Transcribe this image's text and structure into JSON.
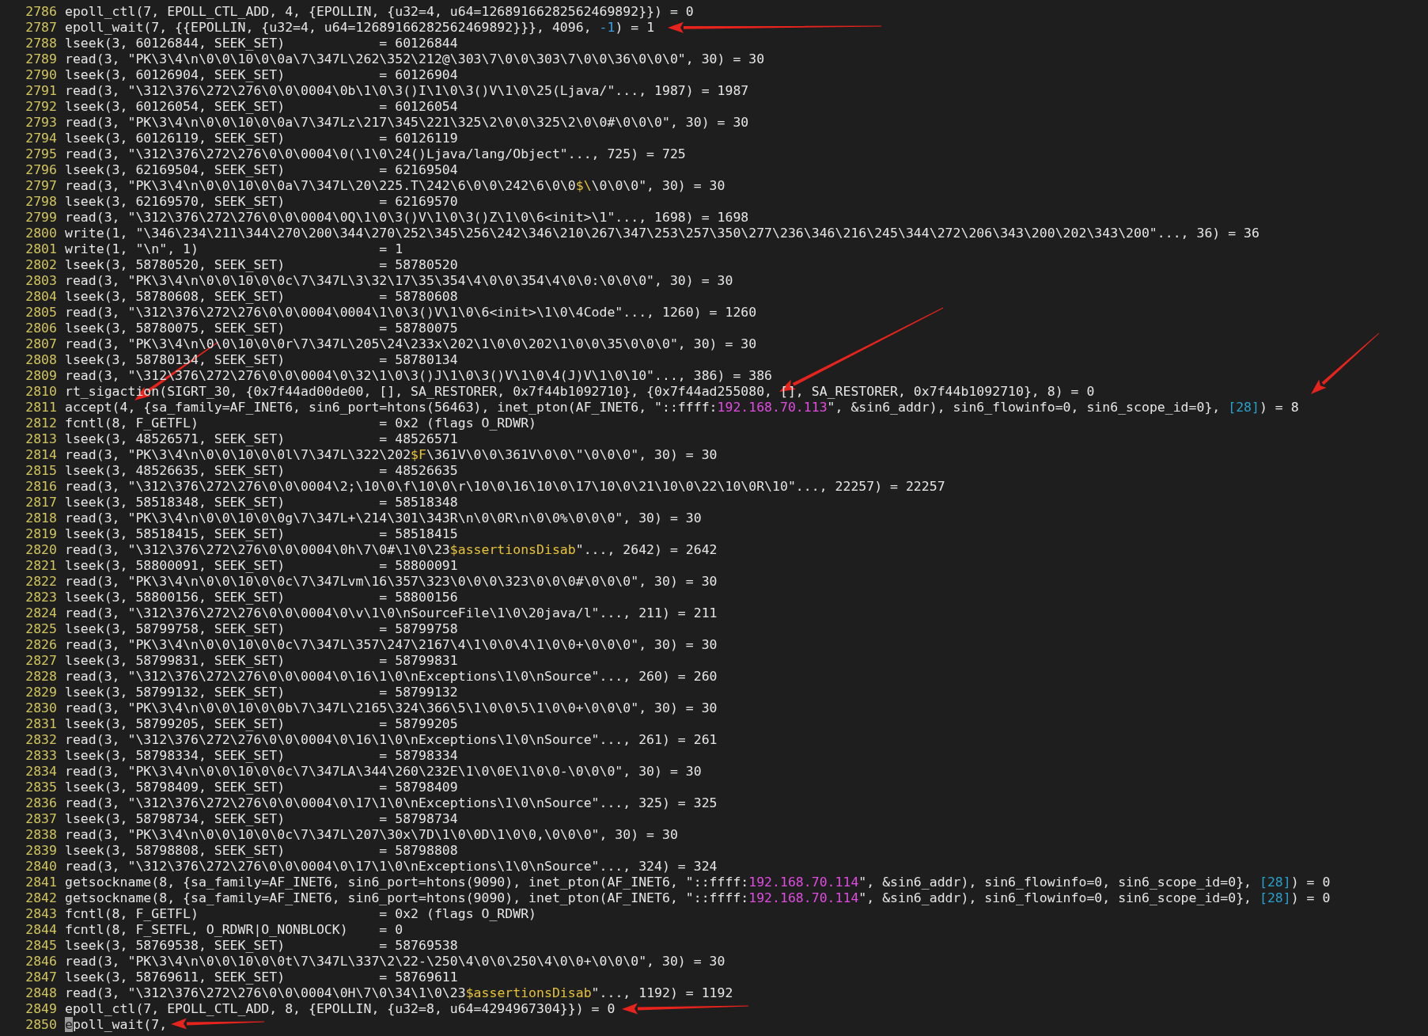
{
  "lines": [
    {
      "number": "2786",
      "segments": [
        {
          "kind": "plain",
          "text": "epoll_ctl(7, EPOLL_CTL_ADD, 4, {EPOLLIN, {u32=4, u64=12689166282562469892}}) = 0"
        }
      ]
    },
    {
      "number": "2787",
      "segments": [
        {
          "kind": "plain",
          "text": "epoll_wait(7, {{EPOLLIN, {u32=4, u64=12689166282562469892}}}, 4096, "
        },
        {
          "kind": "number",
          "text": "-1"
        },
        {
          "kind": "plain",
          "text": ") = 1"
        }
      ]
    },
    {
      "number": "2788",
      "segments": [
        {
          "kind": "plain",
          "text": "lseek(3, 60126844, SEEK_SET)            = 60126844"
        }
      ]
    },
    {
      "number": "2789",
      "segments": [
        {
          "kind": "plain",
          "text": "read(3, \"PK\\3\\4\\n\\0\\0\\10\\0\\0a\\7\\347L\\262\\352\\212@\\303\\7\\0\\0\\303\\7\\0\\0\\36\\0\\0\\0\", 30) = 30"
        }
      ]
    },
    {
      "number": "2790",
      "segments": [
        {
          "kind": "plain",
          "text": "lseek(3, 60126904, SEEK_SET)            = 60126904"
        }
      ]
    },
    {
      "number": "2791",
      "segments": [
        {
          "kind": "plain",
          "text": "read(3, \"\\312\\376\\272\\276\\0\\0\\0004\\0b\\1\\0\\3()I\\1\\0\\3()V\\1\\0\\25(Ljava/\"..., 1987) = 1987"
        }
      ]
    },
    {
      "number": "2792",
      "segments": [
        {
          "kind": "plain",
          "text": "lseek(3, 60126054, SEEK_SET)            = 60126054"
        }
      ]
    },
    {
      "number": "2793",
      "segments": [
        {
          "kind": "plain",
          "text": "read(3, \"PK\\3\\4\\n\\0\\0\\10\\0\\0a\\7\\347Lz\\217\\345\\221\\325\\2\\0\\0\\325\\2\\0\\0#\\0\\0\\0\", 30) = 30"
        }
      ]
    },
    {
      "number": "2794",
      "segments": [
        {
          "kind": "plain",
          "text": "lseek(3, 60126119, SEEK_SET)            = 60126119"
        }
      ]
    },
    {
      "number": "2795",
      "segments": [
        {
          "kind": "plain",
          "text": "read(3, \"\\312\\376\\272\\276\\0\\0\\0004\\0(\\1\\0\\24()Ljava/lang/Object\"..., 725) = 725"
        }
      ]
    },
    {
      "number": "2796",
      "segments": [
        {
          "kind": "plain",
          "text": "lseek(3, 62169504, SEEK_SET)            = 62169504"
        }
      ]
    },
    {
      "number": "2797",
      "segments": [
        {
          "kind": "plain",
          "text": "read(3, \"PK\\3\\4\\n\\0\\0\\10\\0\\0a\\7\\347L\\20\\225.T\\242\\6\\0\\0\\242\\6\\0\\0"
        },
        {
          "kind": "special",
          "text": "$\\"
        },
        {
          "kind": "plain",
          "text": "\\0\\0\\0\", 30) = 30"
        }
      ]
    },
    {
      "number": "2798",
      "segments": [
        {
          "kind": "plain",
          "text": "lseek(3, 62169570, SEEK_SET)            = 62169570"
        }
      ]
    },
    {
      "number": "2799",
      "segments": [
        {
          "kind": "plain",
          "text": "read(3, \"\\312\\376\\272\\276\\0\\0\\0004\\0Q\\1\\0\\3()V\\1\\0\\3()Z\\1\\0\\6<init>\\1\"..., 1698) = 1698"
        }
      ]
    },
    {
      "number": "2800",
      "segments": [
        {
          "kind": "plain",
          "text": "write(1, \"\\346\\234\\211\\344\\270\\200\\344\\270\\252\\345\\256\\242\\346\\210\\267\\347\\253\\257\\350\\277\\236\\346\\216\\245\\344\\272\\206\\343\\200\\202\\343\\200\"..., 36) = 36"
        }
      ]
    },
    {
      "number": "2801",
      "segments": [
        {
          "kind": "plain",
          "text": "write(1, \"\\n\", 1)                       = 1"
        }
      ]
    },
    {
      "number": "2802",
      "segments": [
        {
          "kind": "plain",
          "text": "lseek(3, 58780520, SEEK_SET)            = 58780520"
        }
      ]
    },
    {
      "number": "2803",
      "segments": [
        {
          "kind": "plain",
          "text": "read(3, \"PK\\3\\4\\n\\0\\0\\10\\0\\0c\\7\\347L\\3\\32\\17\\35\\354\\4\\0\\0\\354\\4\\0\\0:\\0\\0\\0\", 30) = 30"
        }
      ]
    },
    {
      "number": "2804",
      "segments": [
        {
          "kind": "plain",
          "text": "lseek(3, 58780608, SEEK_SET)            = 58780608"
        }
      ]
    },
    {
      "number": "2805",
      "segments": [
        {
          "kind": "plain",
          "text": "read(3, \"\\312\\376\\272\\276\\0\\0\\0004\\0004\\1\\0\\3()V\\1\\0\\6<init>\\1\\0\\4Code\"..., 1260) = 1260"
        }
      ]
    },
    {
      "number": "2806",
      "segments": [
        {
          "kind": "plain",
          "text": "lseek(3, 58780075, SEEK_SET)            = 58780075"
        }
      ]
    },
    {
      "number": "2807",
      "segments": [
        {
          "kind": "plain",
          "text": "read(3, \"PK\\3\\4\\n\\0\\0\\10\\0\\0r\\7\\347L\\205\\24\\233x\\202\\1\\0\\0\\202\\1\\0\\0\\35\\0\\0\\0\", 30) = 30"
        }
      ]
    },
    {
      "number": "2808",
      "segments": [
        {
          "kind": "plain",
          "text": "lseek(3, 58780134, SEEK_SET)            = 58780134"
        }
      ]
    },
    {
      "number": "2809",
      "segments": [
        {
          "kind": "plain",
          "text": "read(3, \"\\312\\376\\272\\276\\0\\0\\0004\\0\\32\\1\\0\\3()J\\1\\0\\3()V\\1\\0\\4(J)V\\1\\0\\10\"..., 386) = 386"
        }
      ]
    },
    {
      "number": "2810",
      "segments": [
        {
          "kind": "plain",
          "text": "rt_sigaction(SIGRT_30, {0x7f44ad00de00, [], SA_RESTORER, 0x7f44b1092710}, {0x7f44ad255080, [], SA_RESTORER, 0x7f44b1092710}, 8) = 0"
        }
      ]
    },
    {
      "number": "2811",
      "segments": [
        {
          "kind": "plain",
          "text": "accept(4, {sa_family=AF_INET6, sin6_port=htons(56463), inet_pton(AF_INET6, \"::ffff:"
        },
        {
          "kind": "address",
          "text": "192.168.70.113"
        },
        {
          "kind": "plain",
          "text": "\", &sin6_addr), sin6_flowinfo=0, sin6_scope_id=0}, "
        },
        {
          "kind": "bracket",
          "text": "[28]"
        },
        {
          "kind": "plain",
          "text": ") = 8"
        }
      ]
    },
    {
      "number": "2812",
      "segments": [
        {
          "kind": "plain",
          "text": "fcntl(8, F_GETFL)                       = 0x2 (flags O_RDWR)"
        }
      ]
    },
    {
      "number": "2813",
      "segments": [
        {
          "kind": "plain",
          "text": "lseek(3, 48526571, SEEK_SET)            = 48526571"
        }
      ]
    },
    {
      "number": "2814",
      "segments": [
        {
          "kind": "plain",
          "text": "read(3, \"PK\\3\\4\\n\\0\\0\\10\\0\\0l\\7\\347L\\322\\202"
        },
        {
          "kind": "special",
          "text": "$F"
        },
        {
          "kind": "plain",
          "text": "\\361V\\0\\0\\361V\\0\\0\\\"\\0\\0\\0\", 30) = 30"
        }
      ]
    },
    {
      "number": "2815",
      "segments": [
        {
          "kind": "plain",
          "text": "lseek(3, 48526635, SEEK_SET)            = 48526635"
        }
      ]
    },
    {
      "number": "2816",
      "segments": [
        {
          "kind": "plain",
          "text": "read(3, \"\\312\\376\\272\\276\\0\\0\\0004\\2;\\10\\0\\f\\10\\0\\r\\10\\0\\16\\10\\0\\17\\10\\0\\21\\10\\0\\22\\10\\0R\\10\"..., 22257) = 22257"
        }
      ]
    },
    {
      "number": "2817",
      "segments": [
        {
          "kind": "plain",
          "text": "lseek(3, 58518348, SEEK_SET)            = 58518348"
        }
      ]
    },
    {
      "number": "2818",
      "segments": [
        {
          "kind": "plain",
          "text": "read(3, \"PK\\3\\4\\n\\0\\0\\10\\0\\0g\\7\\347L+\\214\\301\\343R\\n\\0\\0R\\n\\0\\0%\\0\\0\\0\", 30) = 30"
        }
      ]
    },
    {
      "number": "2819",
      "segments": [
        {
          "kind": "plain",
          "text": "lseek(3, 58518415, SEEK_SET)            = 58518415"
        }
      ]
    },
    {
      "number": "2820",
      "segments": [
        {
          "kind": "plain",
          "text": "read(3, \"\\312\\376\\272\\276\\0\\0\\0004\\0h\\7\\0#\\1\\0\\23"
        },
        {
          "kind": "special",
          "text": "$assertionsDisab"
        },
        {
          "kind": "plain",
          "text": "\"..., 2642) = 2642"
        }
      ]
    },
    {
      "number": "2821",
      "segments": [
        {
          "kind": "plain",
          "text": "lseek(3, 58800091, SEEK_SET)            = 58800091"
        }
      ]
    },
    {
      "number": "2822",
      "segments": [
        {
          "kind": "plain",
          "text": "read(3, \"PK\\3\\4\\n\\0\\0\\10\\0\\0c\\7\\347Lvm\\16\\357\\323\\0\\0\\0\\323\\0\\0\\0#\\0\\0\\0\", 30) = 30"
        }
      ]
    },
    {
      "number": "2823",
      "segments": [
        {
          "kind": "plain",
          "text": "lseek(3, 58800156, SEEK_SET)            = 58800156"
        }
      ]
    },
    {
      "number": "2824",
      "segments": [
        {
          "kind": "plain",
          "text": "read(3, \"\\312\\376\\272\\276\\0\\0\\0004\\0\\v\\1\\0\\nSourceFile\\1\\0\\20java/l\"..., 211) = 211"
        }
      ]
    },
    {
      "number": "2825",
      "segments": [
        {
          "kind": "plain",
          "text": "lseek(3, 58799758, SEEK_SET)            = 58799758"
        }
      ]
    },
    {
      "number": "2826",
      "segments": [
        {
          "kind": "plain",
          "text": "read(3, \"PK\\3\\4\\n\\0\\0\\10\\0\\0c\\7\\347L\\357\\247\\2167\\4\\1\\0\\0\\4\\1\\0\\0+\\0\\0\\0\", 30) = 30"
        }
      ]
    },
    {
      "number": "2827",
      "segments": [
        {
          "kind": "plain",
          "text": "lseek(3, 58799831, SEEK_SET)            = 58799831"
        }
      ]
    },
    {
      "number": "2828",
      "segments": [
        {
          "kind": "plain",
          "text": "read(3, \"\\312\\376\\272\\276\\0\\0\\0004\\0\\16\\1\\0\\nExceptions\\1\\0\\nSource\"..., 260) = 260"
        }
      ]
    },
    {
      "number": "2829",
      "segments": [
        {
          "kind": "plain",
          "text": "lseek(3, 58799132, SEEK_SET)            = 58799132"
        }
      ]
    },
    {
      "number": "2830",
      "segments": [
        {
          "kind": "plain",
          "text": "read(3, \"PK\\3\\4\\n\\0\\0\\10\\0\\0b\\7\\347L\\2165\\324\\366\\5\\1\\0\\0\\5\\1\\0\\0+\\0\\0\\0\", 30) = 30"
        }
      ]
    },
    {
      "number": "2831",
      "segments": [
        {
          "kind": "plain",
          "text": "lseek(3, 58799205, SEEK_SET)            = 58799205"
        }
      ]
    },
    {
      "number": "2832",
      "segments": [
        {
          "kind": "plain",
          "text": "read(3, \"\\312\\376\\272\\276\\0\\0\\0004\\0\\16\\1\\0\\nExceptions\\1\\0\\nSource\"..., 261) = 261"
        }
      ]
    },
    {
      "number": "2833",
      "segments": [
        {
          "kind": "plain",
          "text": "lseek(3, 58798334, SEEK_SET)            = 58798334"
        }
      ]
    },
    {
      "number": "2834",
      "segments": [
        {
          "kind": "plain",
          "text": "read(3, \"PK\\3\\4\\n\\0\\0\\10\\0\\0c\\7\\347LA\\344\\260\\232E\\1\\0\\0E\\1\\0\\0-\\0\\0\\0\", 30) = 30"
        }
      ]
    },
    {
      "number": "2835",
      "segments": [
        {
          "kind": "plain",
          "text": "lseek(3, 58798409, SEEK_SET)            = 58798409"
        }
      ]
    },
    {
      "number": "2836",
      "segments": [
        {
          "kind": "plain",
          "text": "read(3, \"\\312\\376\\272\\276\\0\\0\\0004\\0\\17\\1\\0\\nExceptions\\1\\0\\nSource\"..., 325) = 325"
        }
      ]
    },
    {
      "number": "2837",
      "segments": [
        {
          "kind": "plain",
          "text": "lseek(3, 58798734, SEEK_SET)            = 58798734"
        }
      ]
    },
    {
      "number": "2838",
      "segments": [
        {
          "kind": "plain",
          "text": "read(3, \"PK\\3\\4\\n\\0\\0\\10\\0\\0c\\7\\347L\\207\\30x\\7D\\1\\0\\0D\\1\\0\\0,\\0\\0\\0\", 30) = 30"
        }
      ]
    },
    {
      "number": "2839",
      "segments": [
        {
          "kind": "plain",
          "text": "lseek(3, 58798808, SEEK_SET)            = 58798808"
        }
      ]
    },
    {
      "number": "2840",
      "segments": [
        {
          "kind": "plain",
          "text": "read(3, \"\\312\\376\\272\\276\\0\\0\\0004\\0\\17\\1\\0\\nExceptions\\1\\0\\nSource\"..., 324) = 324"
        }
      ]
    },
    {
      "number": "2841",
      "segments": [
        {
          "kind": "plain",
          "text": "getsockname(8, {sa_family=AF_INET6, sin6_port=htons(9090), inet_pton(AF_INET6, \"::ffff:"
        },
        {
          "kind": "address",
          "text": "192.168.70.114"
        },
        {
          "kind": "plain",
          "text": "\", &sin6_addr), sin6_flowinfo=0, sin6_scope_id=0}, "
        },
        {
          "kind": "bracket",
          "text": "[28]"
        },
        {
          "kind": "plain",
          "text": ") = 0"
        }
      ]
    },
    {
      "number": "2842",
      "segments": [
        {
          "kind": "plain",
          "text": "getsockname(8, {sa_family=AF_INET6, sin6_port=htons(9090), inet_pton(AF_INET6, \"::ffff:"
        },
        {
          "kind": "address",
          "text": "192.168.70.114"
        },
        {
          "kind": "plain",
          "text": "\", &sin6_addr), sin6_flowinfo=0, sin6_scope_id=0}, "
        },
        {
          "kind": "bracket",
          "text": "[28]"
        },
        {
          "kind": "plain",
          "text": ") = 0"
        }
      ]
    },
    {
      "number": "2843",
      "segments": [
        {
          "kind": "plain",
          "text": "fcntl(8, F_GETFL)                       = 0x2 (flags O_RDWR)"
        }
      ]
    },
    {
      "number": "2844",
      "segments": [
        {
          "kind": "plain",
          "text": "fcntl(8, F_SETFL, O_RDWR|O_NONBLOCK)    = 0"
        }
      ]
    },
    {
      "number": "2845",
      "segments": [
        {
          "kind": "plain",
          "text": "lseek(3, 58769538, SEEK_SET)            = 58769538"
        }
      ]
    },
    {
      "number": "2846",
      "segments": [
        {
          "kind": "plain",
          "text": "read(3, \"PK\\3\\4\\n\\0\\0\\10\\0\\0t\\7\\347L\\337\\2\\22-\\250\\4\\0\\0\\250\\4\\0\\0+\\0\\0\\0\", 30) = 30"
        }
      ]
    },
    {
      "number": "2847",
      "segments": [
        {
          "kind": "plain",
          "text": "lseek(3, 58769611, SEEK_SET)            = 58769611"
        }
      ]
    },
    {
      "number": "2848",
      "segments": [
        {
          "kind": "plain",
          "text": "read(3, \"\\312\\376\\272\\276\\0\\0\\0004\\0H\\7\\0\\34\\1\\0\\23"
        },
        {
          "kind": "special",
          "text": "$assertionsDisab"
        },
        {
          "kind": "plain",
          "text": "\"..., 1192) = 1192"
        }
      ]
    },
    {
      "number": "2849",
      "segments": [
        {
          "kind": "plain",
          "text": "epoll_ctl(7, EPOLL_CTL_ADD, 8, {EPOLLIN, {u32=8, u64=4294967304}}) = 0"
        }
      ]
    },
    {
      "number": "2850",
      "segments": [
        {
          "kind": "cursor",
          "text": "e"
        },
        {
          "kind": "plain",
          "text": "poll_wait(7,"
        }
      ]
    }
  ]
}
